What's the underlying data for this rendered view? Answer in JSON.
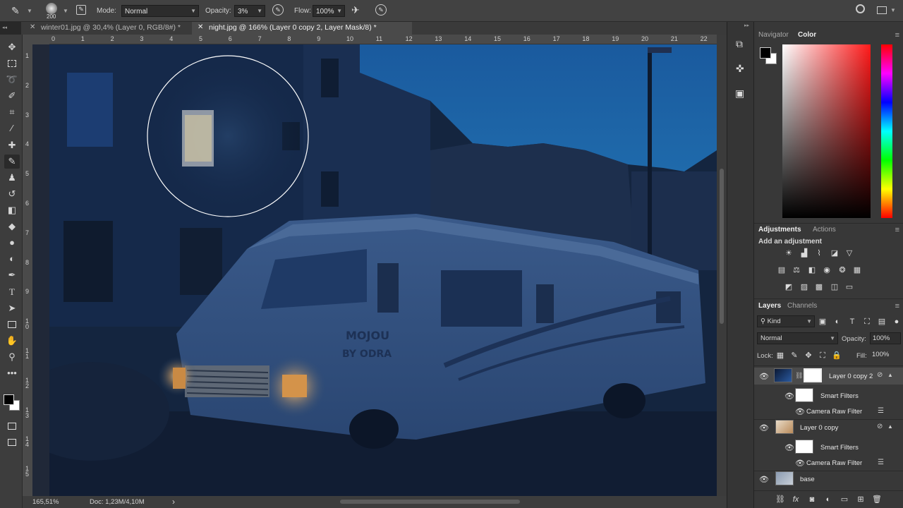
{
  "options_bar": {
    "brush_size": "200",
    "mode_label": "Mode:",
    "mode_value": "Normal",
    "opacity_label": "Opacity:",
    "opacity_value": "3%",
    "flow_label": "Flow:",
    "flow_value": "100%"
  },
  "tabs": [
    {
      "label": "winter01.jpg @ 30,4% (Layer 0, RGB/8#) *"
    },
    {
      "label": "night.jpg @ 166% (Layer 0 copy 2, Layer Mask/8) *"
    }
  ],
  "ruler": {
    "h_ticks": [
      "0",
      "1",
      "2",
      "3",
      "4",
      "5",
      "6",
      "7",
      "8",
      "9",
      "10",
      "11",
      "12",
      "13",
      "14",
      "15",
      "16",
      "17",
      "18",
      "19",
      "20",
      "21",
      "22"
    ],
    "v_ticks": [
      "1",
      "2",
      "3",
      "4",
      "5",
      "6",
      "7",
      "8",
      "9",
      "1\n0",
      "1\n1",
      "1\n2",
      "1\n3",
      "1\n4",
      "1\n5"
    ]
  },
  "canvas": {
    "van_text_1": "MOJOU",
    "van_text_2": "BY ODRA"
  },
  "status": {
    "zoom": "165,51%",
    "doc": "Doc: 1,23M/4,10M",
    "arrow": "›"
  },
  "navigator": {
    "tab1": "Navigator",
    "tab2": "Color"
  },
  "adjustments": {
    "tab1": "Adjustments",
    "tab2": "Actions",
    "hint": "Add an adjustment"
  },
  "layers_panel": {
    "tab1": "Layers",
    "tab2": "Channels",
    "kind": "Kind",
    "blend": "Normal",
    "opacity_label": "Opacity:",
    "opacity_value": "100%",
    "lock_label": "Lock:",
    "fill_label": "Fill:",
    "fill_value": "100%",
    "layers": [
      {
        "name": "Layer 0 copy 2"
      },
      {
        "name": "Smart Filters"
      },
      {
        "name": "Camera Raw Filter"
      },
      {
        "name": "Layer 0 copy"
      },
      {
        "name": "Smart Filters"
      },
      {
        "name": "Camera Raw Filter"
      },
      {
        "name": "base"
      }
    ]
  },
  "colors": {
    "accent": "#1e73be",
    "bg": "#282828",
    "panel": "#383838"
  }
}
